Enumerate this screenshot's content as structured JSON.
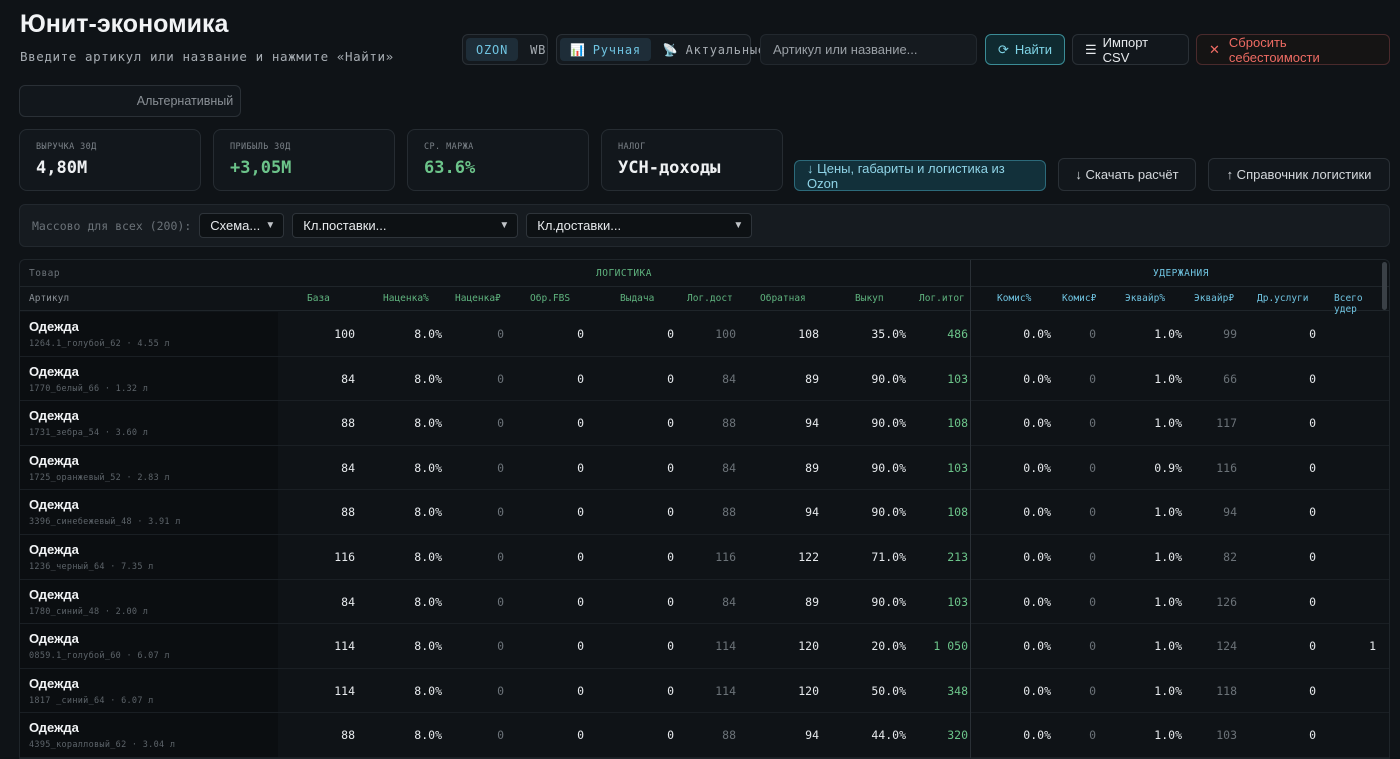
{
  "header": {
    "title": "Юнит-экономика",
    "subtitle": "Введите артикул или название и нажмите «Найти»"
  },
  "marketplace": {
    "options": [
      "OZON",
      "WB"
    ],
    "active": "OZON"
  },
  "mode": {
    "manual": "Ручная",
    "actual": "Актуальные",
    "active": "Ручная"
  },
  "search": {
    "placeholder": "Артикул или название...",
    "value": ""
  },
  "buttons": {
    "find": "Найти",
    "import_csv": "Импорт CSV",
    "reset_cost": "Сбросить себестоимости",
    "ozon_prices": "↓ Цены, габариты и логистика из Ozon",
    "download": "↓ Скачать расчёт",
    "logistics_ref": "↑ Справочник логистики"
  },
  "view_tabs": {
    "primary": "",
    "alternative": "Альтернативный"
  },
  "kpis": [
    {
      "label": "ВЫРУЧКА 30Д",
      "value": "4,80М"
    },
    {
      "label": "ПРИБЫЛЬ 30Д",
      "value": "+3,05М"
    },
    {
      "label": "СР. МАРЖА",
      "value": "63.6%"
    },
    {
      "label": "НАЛОГ",
      "value": "УСН-доходы"
    }
  ],
  "bulk": {
    "label": "Массово для всех (200):",
    "scheme": "Схема...",
    "supply_cluster": "Кл.поставки...",
    "delivery_cluster": "Кл.доставки..."
  },
  "table": {
    "product_label": "Товар",
    "article_label": "Артикул",
    "group_logistics": "ЛОГИСТИКА",
    "group_deductions": "УДЕРЖАНИЯ",
    "columns": [
      "База",
      "Наценка%",
      "Наценка₽",
      "Обр.FBS",
      "Выдача",
      "Лог.дост",
      "Обратная",
      "Выкуп",
      "Лог.итог",
      "Комис%",
      "Комис₽",
      "Эквайр%",
      "Эквайр₽",
      "Др.услуги",
      "Всего удер"
    ],
    "rows": [
      {
        "name": "Одежда",
        "sub": "1264.1_голубой_62 · 4.55 л",
        "cells": [
          "100",
          "8.0%",
          "0",
          "0",
          "0",
          "100",
          "108",
          "35.0%",
          "486",
          "0.0%",
          "0",
          "1.0%",
          "99",
          "0",
          ""
        ]
      },
      {
        "name": "Одежда",
        "sub": "1770_белый_66 · 1.32 л",
        "cells": [
          "84",
          "8.0%",
          "0",
          "0",
          "0",
          "84",
          "89",
          "90.0%",
          "103",
          "0.0%",
          "0",
          "1.0%",
          "66",
          "0",
          ""
        ]
      },
      {
        "name": "Одежда",
        "sub": "1731_зебра_54 · 3.60 л",
        "cells": [
          "88",
          "8.0%",
          "0",
          "0",
          "0",
          "88",
          "94",
          "90.0%",
          "108",
          "0.0%",
          "0",
          "1.0%",
          "117",
          "0",
          ""
        ]
      },
      {
        "name": "Одежда",
        "sub": "1725_оранжевый_52 · 2.83 л",
        "cells": [
          "84",
          "8.0%",
          "0",
          "0",
          "0",
          "84",
          "89",
          "90.0%",
          "103",
          "0.0%",
          "0",
          "0.9%",
          "116",
          "0",
          ""
        ]
      },
      {
        "name": "Одежда",
        "sub": "3396_синебежевый_48 · 3.91 л",
        "cells": [
          "88",
          "8.0%",
          "0",
          "0",
          "0",
          "88",
          "94",
          "90.0%",
          "108",
          "0.0%",
          "0",
          "1.0%",
          "94",
          "0",
          ""
        ]
      },
      {
        "name": "Одежда",
        "sub": "1236_черный_64 · 7.35 л",
        "cells": [
          "116",
          "8.0%",
          "0",
          "0",
          "0",
          "116",
          "122",
          "71.0%",
          "213",
          "0.0%",
          "0",
          "1.0%",
          "82",
          "0",
          ""
        ]
      },
      {
        "name": "Одежда",
        "sub": "1780_синий_48 · 2.00 л",
        "cells": [
          "84",
          "8.0%",
          "0",
          "0",
          "0",
          "84",
          "89",
          "90.0%",
          "103",
          "0.0%",
          "0",
          "1.0%",
          "126",
          "0",
          ""
        ]
      },
      {
        "name": "Одежда",
        "sub": "0859.1_голубой_60 · 6.07 л",
        "cells": [
          "114",
          "8.0%",
          "0",
          "0",
          "0",
          "114",
          "120",
          "20.0%",
          "1 050",
          "0.0%",
          "0",
          "1.0%",
          "124",
          "0",
          "1"
        ]
      },
      {
        "name": "Одежда",
        "sub": "1817 _синий_64 · 6.07 л",
        "cells": [
          "114",
          "8.0%",
          "0",
          "0",
          "0",
          "114",
          "120",
          "50.0%",
          "348",
          "0.0%",
          "0",
          "1.0%",
          "118",
          "0",
          ""
        ]
      },
      {
        "name": "Одежда",
        "sub": "4395_коралловый_62 · 3.04 л",
        "cells": [
          "88",
          "8.0%",
          "0",
          "0",
          "0",
          "88",
          "94",
          "44.0%",
          "320",
          "0.0%",
          "0",
          "1.0%",
          "103",
          "0",
          ""
        ]
      }
    ]
  }
}
